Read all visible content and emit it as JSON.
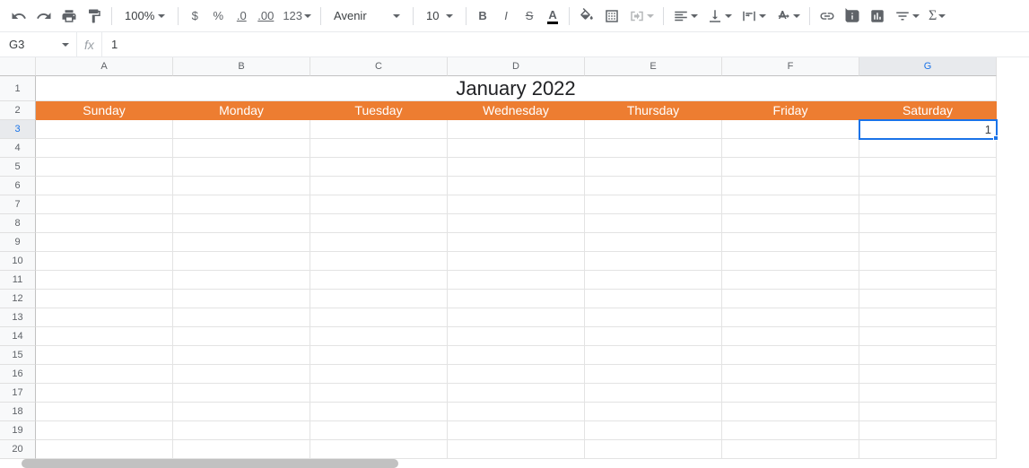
{
  "toolbar": {
    "zoom_level": "100%",
    "currency_label": "$",
    "percent_label": "%",
    "dec_decrease_label": ".0",
    "dec_increase_label": ".00",
    "format_more_label": "123",
    "font_name": "Avenir",
    "font_size": "10",
    "bold_label": "B",
    "italic_label": "I",
    "strike_label": "S",
    "text_color_label": "A"
  },
  "formula_bar": {
    "name_box": "G3",
    "fx_label": "fx",
    "formula_value": "1"
  },
  "columns": [
    "A",
    "B",
    "C",
    "D",
    "E",
    "F",
    "G"
  ],
  "rows": [
    "1",
    "2",
    "3",
    "4",
    "5",
    "6",
    "7",
    "8",
    "9",
    "10",
    "11",
    "12",
    "13",
    "14",
    "15",
    "16",
    "17",
    "18",
    "19",
    "20"
  ],
  "sheet": {
    "title": "January 2022",
    "day_headers": [
      "Sunday",
      "Monday",
      "Tuesday",
      "Wednesday",
      "Thursday",
      "Friday",
      "Saturday"
    ],
    "g3_value": "1"
  },
  "colors": {
    "accent_orange": "#ed7d31",
    "selection_blue": "#1a73e8"
  },
  "selected_cell": "G3"
}
